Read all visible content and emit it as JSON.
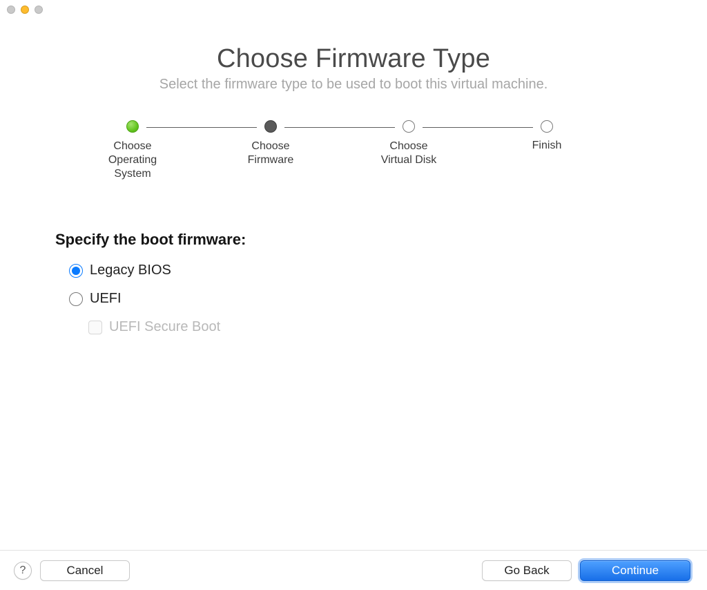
{
  "header": {
    "title": "Choose Firmware Type",
    "subtitle": "Select the firmware type to be used to boot this virtual machine."
  },
  "stepper": {
    "steps": [
      {
        "label": "Choose Operating System",
        "state": "complete"
      },
      {
        "label": "Choose Firmware",
        "state": "current"
      },
      {
        "label": "Choose Virtual Disk",
        "state": "future"
      },
      {
        "label": "Finish",
        "state": "future"
      }
    ]
  },
  "section": {
    "heading": "Specify the boot firmware:"
  },
  "options": {
    "legacy_bios": {
      "label": "Legacy BIOS",
      "selected": true
    },
    "uefi": {
      "label": "UEFI",
      "selected": false
    },
    "secure_boot": {
      "label": "UEFI Secure Boot",
      "checked": false,
      "enabled": false
    }
  },
  "footer": {
    "help_label": "?",
    "cancel": "Cancel",
    "go_back": "Go Back",
    "continue": "Continue"
  }
}
